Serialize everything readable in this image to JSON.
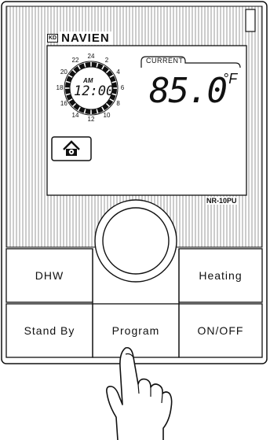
{
  "brand": {
    "badge": "KD",
    "name": "NAVIEN"
  },
  "model": "NR-10PU",
  "display": {
    "current_label": "CURRENT",
    "time": "12:00",
    "ampm": "AM",
    "temperature": "85.0",
    "unit": "°F",
    "dial_numbers": [
      "22",
      "24",
      "2",
      "4",
      "6",
      "8",
      "10",
      "12",
      "14",
      "16",
      "18",
      "20"
    ],
    "home_icon": "home-fan-icon"
  },
  "buttons": {
    "dhw": "DHW",
    "heating": "Heating",
    "standby": "Stand By",
    "program": "Program",
    "onoff": "ON/OFF"
  },
  "icons": {
    "dial": "rotary-dial-knob",
    "hand": "pointing-hand-icon"
  }
}
